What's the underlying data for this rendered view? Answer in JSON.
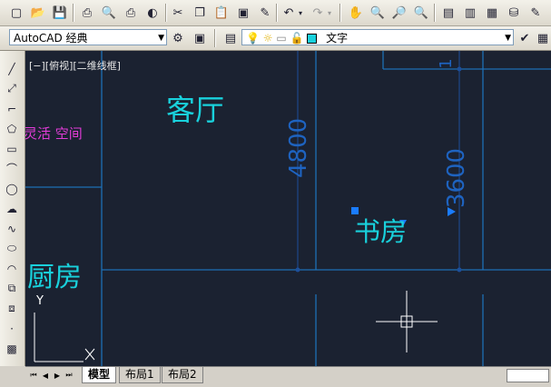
{
  "workspace": {
    "selected": "AutoCAD 经典"
  },
  "layer_text": "文字",
  "viewport_label": "[−][俯视][二维线框]",
  "rooms": {
    "living": "客厅",
    "study": "书房",
    "kitchen": "厨房",
    "flexible": "灵活 空间"
  },
  "dims": {
    "d4800": "4800",
    "d3600": "3600",
    "d1": "1"
  },
  "ucs": {
    "y": "Y",
    "x": "X"
  },
  "tabs": [
    {
      "label": "模型",
      "active": true
    },
    {
      "label": "布局1",
      "active": false
    },
    {
      "label": "布局2",
      "active": false
    }
  ],
  "colors": {
    "canvas": "#1b2231",
    "line": "#1e6fb5",
    "text": "#19d1dc",
    "magenta": "#e23cd8",
    "dim": "#1d4f9a"
  }
}
